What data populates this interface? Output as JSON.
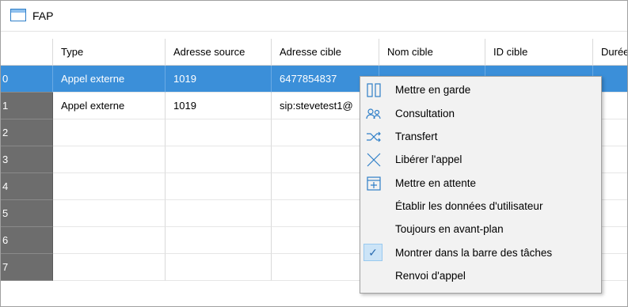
{
  "window": {
    "title": "FAP"
  },
  "grid": {
    "columns": [
      "Type",
      "Adresse source",
      "Adresse cible",
      "Nom cible",
      "ID cible",
      "Durée"
    ],
    "rows": [
      {
        "index": "0",
        "type": "Appel externe",
        "source": "1019",
        "target": "6477854837",
        "name": "",
        "id": "",
        "duration": ""
      },
      {
        "index": "1",
        "type": "Appel externe",
        "source": "1019",
        "target": "sip:stevetest1@",
        "name": "",
        "id": "",
        "duration": ""
      },
      {
        "index": "2"
      },
      {
        "index": "3"
      },
      {
        "index": "4"
      },
      {
        "index": "5"
      },
      {
        "index": "6"
      },
      {
        "index": "7"
      }
    ],
    "selected_row": 0
  },
  "context_menu": {
    "items": [
      {
        "label": "Mettre en garde",
        "icon": "hold-icon"
      },
      {
        "label": "Consultation",
        "icon": "consultation-icon"
      },
      {
        "label": "Transfert",
        "icon": "transfer-icon"
      },
      {
        "label": "Libérer l'appel",
        "icon": "release-call-icon"
      },
      {
        "label": "Mettre en attente",
        "icon": "park-call-icon"
      },
      {
        "label": "Établir les données d'utilisateur",
        "icon": ""
      },
      {
        "label": "Toujours en avant-plan",
        "icon": ""
      },
      {
        "label": "Montrer dans la barre des tâches",
        "icon": "check-icon",
        "checked": true
      },
      {
        "label": "Renvoi d'appel",
        "icon": ""
      }
    ]
  },
  "colors": {
    "selection": "#3b8fd9",
    "row_header": "#6d6d6d",
    "menu_bg": "#f2f2f2"
  }
}
